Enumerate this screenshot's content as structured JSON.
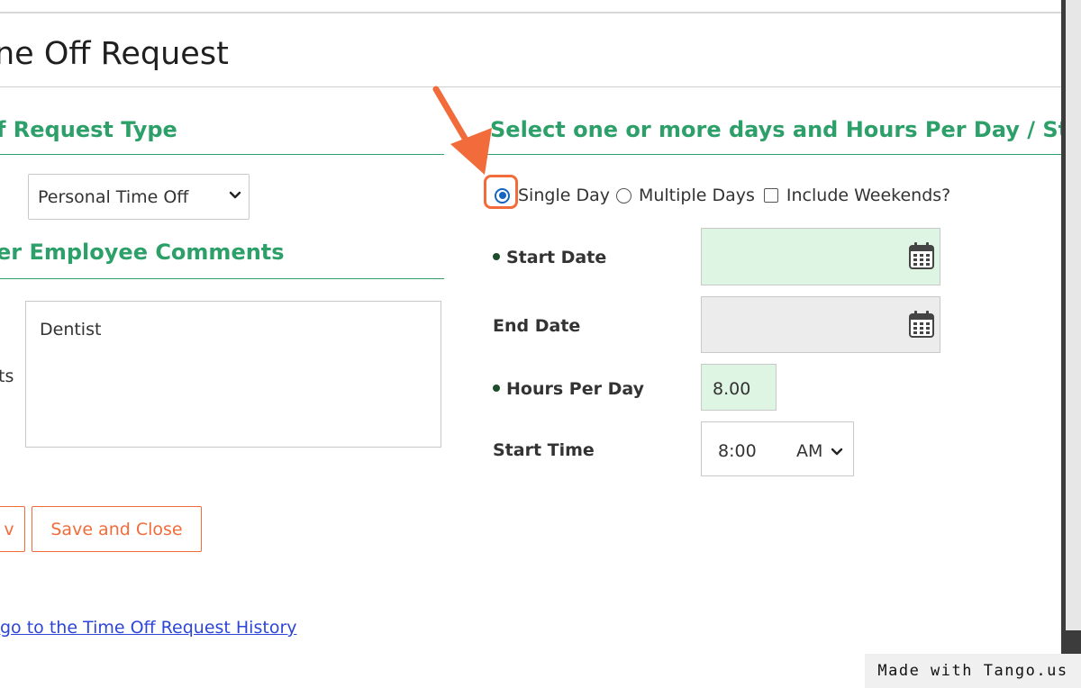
{
  "page": {
    "title": "ne Off Request"
  },
  "left": {
    "request_type_heading": "f Request Type",
    "request_type_select": "Personal Time Off",
    "comments_heading": "er Employee Comments",
    "comments_label_fragment": "ts",
    "comments_value": "Dentist",
    "partial_button_label": "v",
    "save_close_label": "Save and Close",
    "history_link": "go to the Time Off Request History"
  },
  "right": {
    "heading": "Select one or more days and Hours Per Day / Star",
    "options": {
      "single_day": "Single Day",
      "multiple_days": "Multiple Days",
      "include_weekends": "Include Weekends?"
    },
    "start_date_label": "Start Date",
    "end_date_label": "End Date",
    "hours_per_day_label": "Hours Per Day",
    "hours_per_day_value": "8.00",
    "start_time_label": "Start Time",
    "start_time_value": "8:00",
    "start_time_ampm": "AM"
  },
  "badge": {
    "text": "Made with Tango.us"
  },
  "colors": {
    "accent_green": "#2da06a",
    "accent_orange": "#f26b3a",
    "link_blue": "#2e46d6",
    "field_green": "#def5e4"
  }
}
